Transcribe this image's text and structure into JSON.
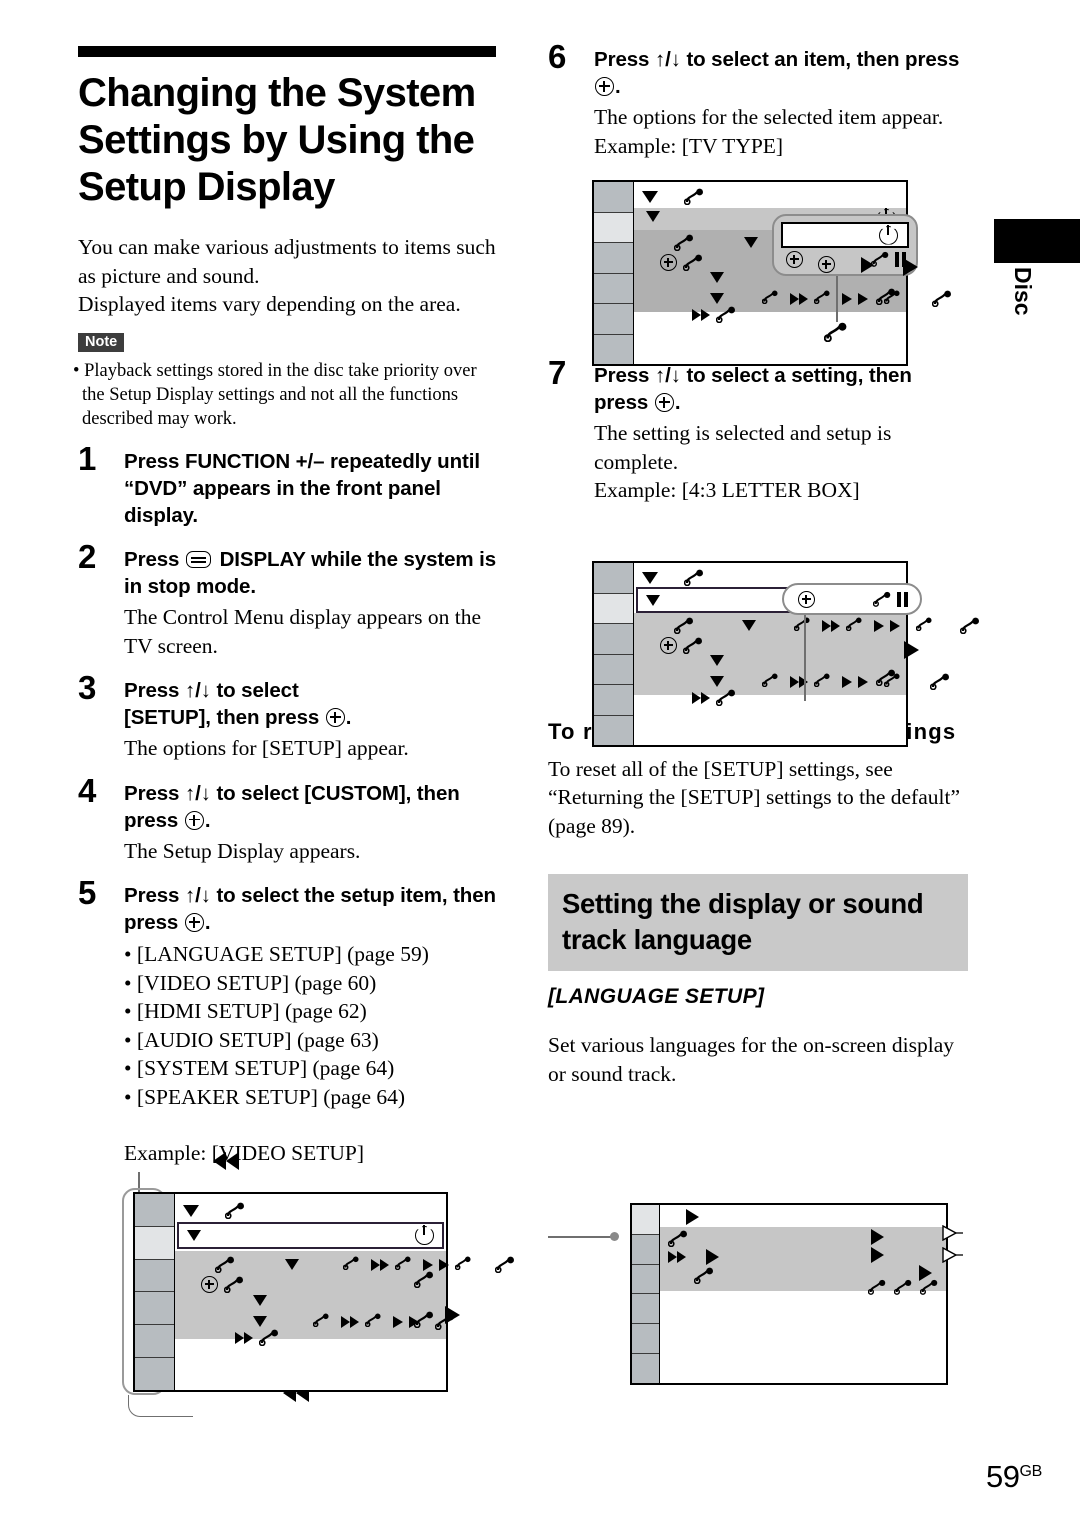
{
  "page": {
    "number": "59",
    "region_suffix": "GB",
    "side_tab_label": "Disc"
  },
  "left_column": {
    "chapter_title": "Changing the System Settings by Using the Setup Display",
    "intro_lines": [
      "You can make various adjustments to items such as picture and sound.",
      "Displayed items vary depending on the area."
    ],
    "note": {
      "badge": "Note",
      "text": "Playback settings stored in the disc take priority over the Setup Display settings and not all the functions described may work."
    },
    "steps": [
      {
        "num": "1",
        "head_parts": [
          "Press FUNCTION +/– repeatedly until “DVD” appears in the front panel display."
        ],
        "body": ""
      },
      {
        "num": "2",
        "head_before": "Press",
        "head_after": "DISPLAY while the system is in stop mode.",
        "body": "The Control Menu display appears on the TV screen."
      },
      {
        "num": "3",
        "head_before": "Press ↑/↓ to select",
        "head_mid": "[SETUP],",
        "head_after": "then press",
        "head_end": ".",
        "body": "The options for [SETUP] appear."
      },
      {
        "num": "4",
        "head_before": "Press ↑/↓ to select [CUSTOM], then press",
        "head_end": ".",
        "body": "The Setup Display appears."
      },
      {
        "num": "5",
        "head_before": "Press ↑/↓ to select the setup item, then press",
        "head_end": ".",
        "body": ""
      }
    ],
    "setup_items": [
      "[LANGUAGE SETUP] (page 59)",
      "[VIDEO SETUP] (page 60)",
      "[HDMI SETUP] (page 62)",
      "[AUDIO SETUP] (page 63)",
      "[SYSTEM SETUP] (page 64)",
      "[SPEAKER SETUP] (page 64)"
    ],
    "example_label": "Example: [VIDEO SETUP]"
  },
  "right_column": {
    "steps": [
      {
        "num": "6",
        "head_before": "Press ↑/↓ to select an item, then press",
        "head_end": ".",
        "body": "The options for the selected item appear.",
        "example": "Example: [TV TYPE]"
      },
      {
        "num": "7",
        "head_before": "Press ↑/↓ to select a setting, then press",
        "head_end": ".",
        "body": "The setting is selected and setup is complete.",
        "example": "Example: [4:3 LETTER BOX]"
      }
    ],
    "reset_heading": "To reset all of the [SETUP] settings",
    "reset_body": "To reset all of the [SETUP] settings, see “Returning the [SETUP] settings to the default” (page 89).",
    "band_heading": "Setting the display or sound track language",
    "italic_heading": "[LANGUAGE SETUP]",
    "band_body": "Set various languages for the on-screen display or sound track."
  },
  "icons": {
    "display_icon": "display-icon",
    "enter_icon": "enter-circle-plus-icon",
    "power_icon": "power-icon",
    "note_glyph": "music-note-glyph",
    "triangle_down": "triangle-down-icon",
    "triangle_right": "triangle-right-icon",
    "fast_forward": "fast-forward-icon",
    "rewind": "rewind-icon",
    "pause": "pause-icon"
  },
  "colors": {
    "band_gray": "#c9c9c9",
    "note_badge": "#3d3d3d",
    "screen_field": "#c6c6c6",
    "screen_field_dark": "#b0b0b0",
    "rail_cell": "#b7bcc0",
    "rail_cell_lit": "#e2e4e6",
    "leader": "#6f6f6f"
  }
}
